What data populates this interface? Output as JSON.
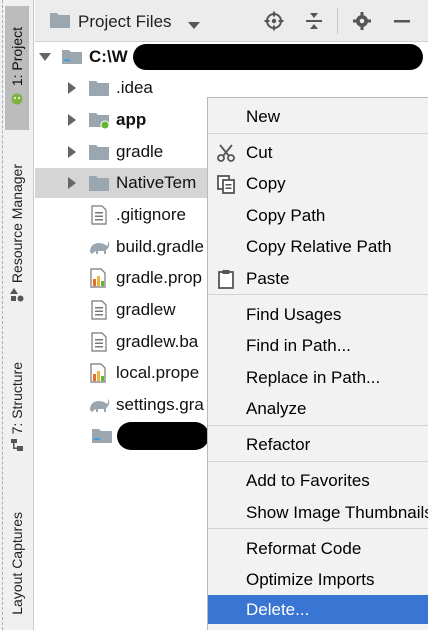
{
  "strip": {
    "project_tab": "1: Project",
    "resource_tab": "Resource Manager",
    "structure_tab": "7: Structure",
    "captures_tab": "Layout Captures"
  },
  "header": {
    "title": "Project Files"
  },
  "tree": [
    {
      "label": "C:\\W",
      "kind": "root",
      "bold": true
    },
    {
      "label": ".idea",
      "kind": "folder"
    },
    {
      "label": "app",
      "kind": "module",
      "bold": true
    },
    {
      "label": "gradle",
      "kind": "folder"
    },
    {
      "label": "NativeTem",
      "kind": "folder",
      "selected": true
    },
    {
      "label": ".gitignore",
      "kind": "file"
    },
    {
      "label": "build.gradle",
      "kind": "gradle"
    },
    {
      "label": "gradle.prop",
      "kind": "props"
    },
    {
      "label": "gradlew",
      "kind": "file"
    },
    {
      "label": "gradlew.ba",
      "kind": "file"
    },
    {
      "label": "local.prope",
      "kind": "props"
    },
    {
      "label": "settings.gra",
      "kind": "gradle"
    },
    {
      "label": "",
      "kind": "module-folder"
    }
  ],
  "menu": {
    "items": [
      {
        "label": "New",
        "icon": ""
      },
      {
        "label": "Cut",
        "icon": "scissors-icon"
      },
      {
        "label": "Copy",
        "icon": "copy-icon"
      },
      {
        "label": "Copy Path",
        "icon": ""
      },
      {
        "label": "Copy Relative Path",
        "icon": ""
      },
      {
        "label": "Paste",
        "icon": "paste-icon"
      },
      {
        "label": "Find Usages",
        "icon": ""
      },
      {
        "label": "Find in Path...",
        "icon": ""
      },
      {
        "label": "Replace in Path...",
        "icon": ""
      },
      {
        "label": "Analyze",
        "icon": ""
      },
      {
        "label": "Refactor",
        "icon": ""
      },
      {
        "label": "Add to Favorites",
        "icon": ""
      },
      {
        "label": "Show Image Thumbnails",
        "icon": ""
      },
      {
        "label": "Reformat Code",
        "icon": ""
      },
      {
        "label": "Optimize Imports",
        "icon": ""
      },
      {
        "label": "Delete...",
        "icon": "",
        "selected": true
      }
    ]
  },
  "colors": {
    "selection": "#3975d3",
    "menu_bg": "#f2f2f2",
    "folder": "#9aa7b0",
    "module_dot": "#5fb832"
  }
}
